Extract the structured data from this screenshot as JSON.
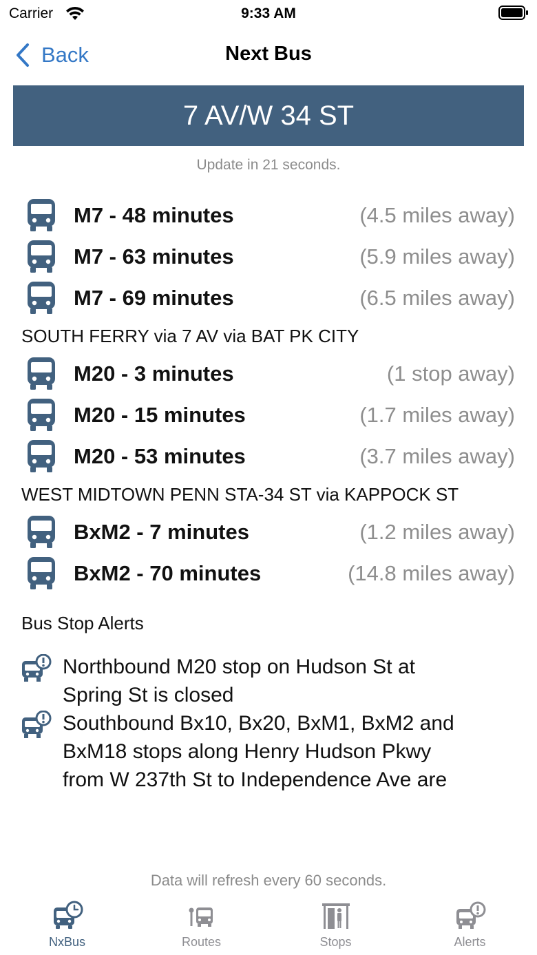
{
  "status_bar": {
    "carrier": "Carrier",
    "time": "9:33 AM"
  },
  "nav": {
    "back_label": "Back",
    "title": "Next Bus"
  },
  "stop_name": "7 AV/W 34 ST",
  "update_note": "Update in 21 seconds.",
  "groups": [
    {
      "destination": "",
      "arrivals": [
        {
          "route": "M7 - 48 minutes",
          "distance": "(4.5 miles away)"
        },
        {
          "route": "M7 - 63 minutes",
          "distance": "(5.9 miles away)"
        },
        {
          "route": "M7 - 69 minutes",
          "distance": "(6.5 miles away)"
        }
      ]
    },
    {
      "destination": "SOUTH FERRY via 7 AV via BAT PK CITY",
      "arrivals": [
        {
          "route": "M20 - 3 minutes",
          "distance": "(1 stop away)"
        },
        {
          "route": "M20 - 15 minutes",
          "distance": "(1.7 miles away)"
        },
        {
          "route": "M20 - 53 minutes",
          "distance": "(3.7 miles away)"
        }
      ]
    },
    {
      "destination": "WEST MIDTOWN PENN STA-34 ST via KAPPOCK ST",
      "arrivals": [
        {
          "route": "BxM2 - 7 minutes",
          "distance": "(1.2 miles away)"
        },
        {
          "route": "BxM2 - 70 minutes",
          "distance": "(14.8 miles away)"
        }
      ]
    }
  ],
  "alerts_title": "Bus Stop Alerts",
  "alerts": [
    {
      "lines": [
        "Northbound M20 stop on Hudson St at",
        "Spring St is closed"
      ]
    },
    {
      "lines": [
        "Southbound Bx10, Bx20, BxM1, BxM2 and",
        "BxM18 stops along Henry Hudson Pkwy",
        "from W 237th St to Independence Ave are"
      ]
    }
  ],
  "refresh_note": "Data will refresh every 60 seconds.",
  "tabs": [
    {
      "label": "NxBus",
      "icon": "bus-clock-icon",
      "active": true
    },
    {
      "label": "Routes",
      "icon": "route-bus-icon",
      "active": false
    },
    {
      "label": "Stops",
      "icon": "bus-stop-icon",
      "active": false
    },
    {
      "label": "Alerts",
      "icon": "bus-alert-icon",
      "active": false
    }
  ],
  "colors": {
    "accent": "#42617f",
    "link": "#3478c6",
    "muted": "#8e8e8e"
  }
}
